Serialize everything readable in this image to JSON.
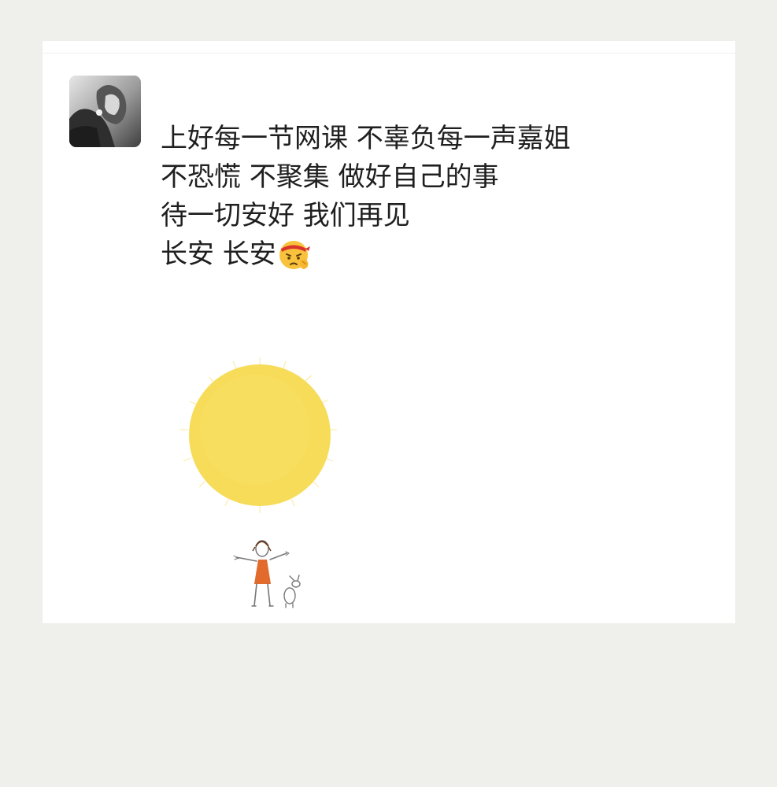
{
  "post": {
    "avatar_icon": "user-avatar-photo",
    "lines": [
      "上好每一节网课 不辜负每一声嘉姐",
      "不恐慌 不聚集 做好自己的事",
      "待一切安好 我们再见",
      "长安 长安"
    ],
    "emoji_icon": "determined-fighting-emoji",
    "image_icon": "sun-girl-rabbit-illustration"
  },
  "colors": {
    "page_bg": "#efefec",
    "card_bg": "#ffffff",
    "text": "#1f1f1f",
    "sun": "#f7dc5a",
    "sun_ray": "#f9e68f"
  }
}
